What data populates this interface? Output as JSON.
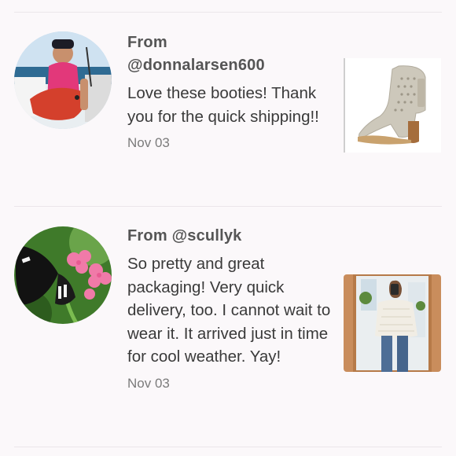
{
  "reviews": [
    {
      "from_prefix": "From",
      "username": "@donnalarsen600",
      "text": "Love these booties! Thank you for the quick shipping!!",
      "date": "Nov 03",
      "avatar_icon": "avatar-fisherman-photo",
      "thumb_icon": "booties-photo"
    },
    {
      "from_prefix": "From",
      "username": "@scullyk",
      "text": "So pretty and great packaging! Very quick delivery, too. I cannot wait to wear it. It arrived just in time for cool weather. Yay!",
      "date": "Nov 03",
      "avatar_icon": "avatar-butterfly-photo",
      "thumb_icon": "sweater-mirror-selfie-photo"
    }
  ],
  "colors": {
    "background": "#fbf8fa",
    "divider": "#ebe6ea",
    "name_text": "#555555",
    "body_text": "#3a3a3a",
    "date_text": "#7b7b7b"
  }
}
